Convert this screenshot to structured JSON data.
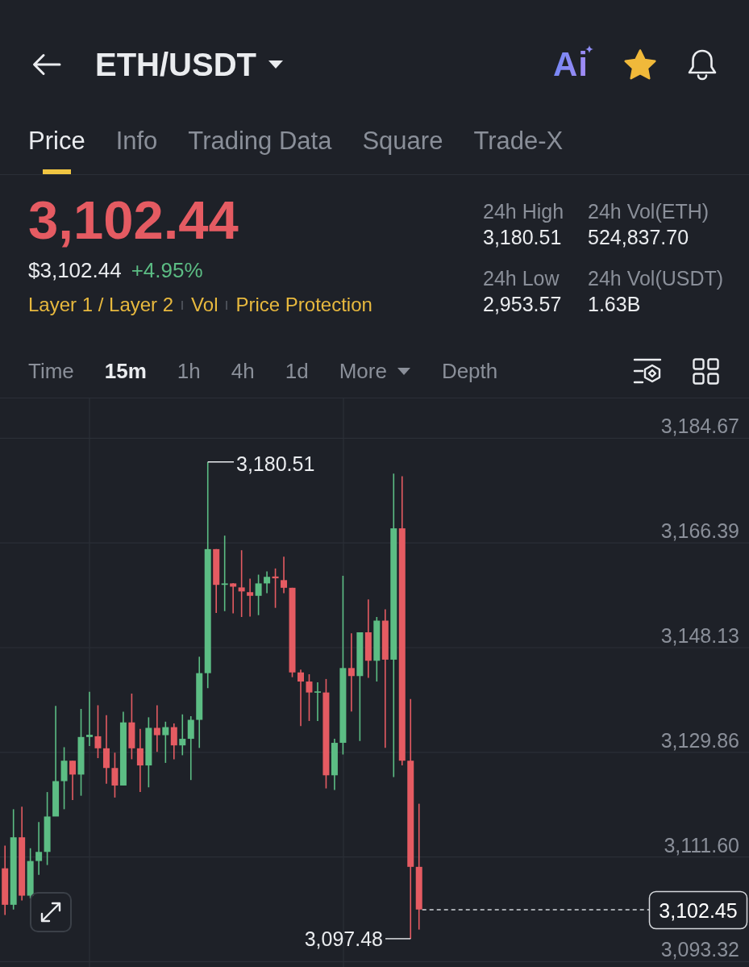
{
  "header": {
    "pair": "ETH/USDT",
    "ai_label": "Ai",
    "favorite": true
  },
  "tabs": [
    {
      "label": "Price",
      "selected": true
    },
    {
      "label": "Info",
      "selected": false
    },
    {
      "label": "Trading Data",
      "selected": false
    },
    {
      "label": "Square",
      "selected": false
    },
    {
      "label": "Trade-X",
      "selected": false
    }
  ],
  "price": {
    "last": "3,102.44",
    "falling": true,
    "fiat": "$3,102.44",
    "change": "+4.95%",
    "change_positive": true,
    "tags": [
      "Layer 1 / Layer 2",
      "Vol",
      "Price Protection"
    ]
  },
  "stats": [
    {
      "label": "24h High",
      "value": "3,180.51"
    },
    {
      "label": "24h Vol(ETH)",
      "value": "524,837.70"
    },
    {
      "label": "24h Low",
      "value": "2,953.57"
    },
    {
      "label": "24h Vol(USDT)",
      "value": "1.63B"
    }
  ],
  "toolbar": {
    "intervals": [
      {
        "label": "Time",
        "selected": false,
        "kind": "option"
      },
      {
        "label": "15m",
        "selected": true,
        "kind": "option"
      },
      {
        "label": "1h",
        "selected": false,
        "kind": "option"
      },
      {
        "label": "4h",
        "selected": false,
        "kind": "option"
      },
      {
        "label": "1d",
        "selected": false,
        "kind": "option"
      },
      {
        "label": "More",
        "selected": false,
        "kind": "dropdown"
      },
      {
        "label": "Depth",
        "selected": false,
        "kind": "option"
      }
    ]
  },
  "chart": {
    "price_axis": [
      "3,184.67",
      "3,166.39",
      "3,148.13",
      "3,129.86",
      "3,111.60",
      "3,093.32"
    ],
    "high_label": "3,180.51",
    "low_label": "3,097.48",
    "last_price": "3,102.45"
  }
}
